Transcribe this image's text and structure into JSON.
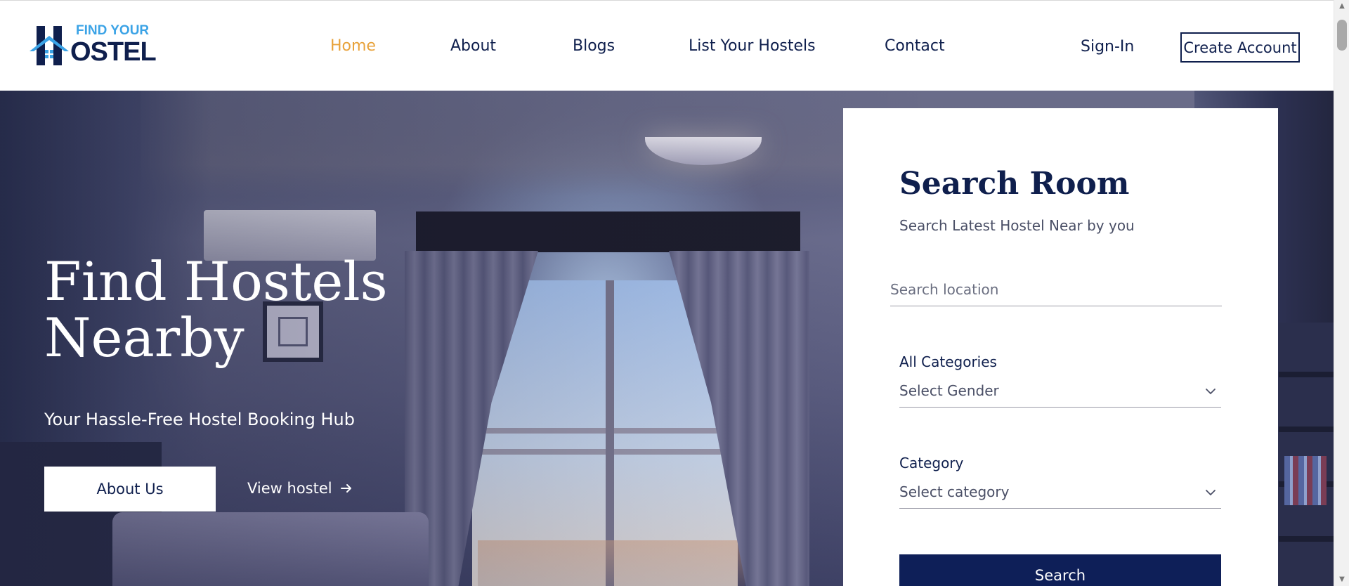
{
  "header": {
    "logo_text_top": "FIND YOUR",
    "logo_text_bottom": "OSTEL",
    "logo_letter": "H",
    "nav": [
      {
        "label": "Home",
        "active": true
      },
      {
        "label": "About",
        "active": false
      },
      {
        "label": "Blogs",
        "active": false
      },
      {
        "label": "List Your Hostels",
        "active": false
      },
      {
        "label": "Contact",
        "active": false
      }
    ],
    "signin_label": "Sign-In",
    "create_account_label": "Create Account"
  },
  "hero": {
    "title_line1": "Find Hostels",
    "title_line2": "Nearby",
    "subtitle": "Your Hassle-Free Hostel Booking Hub",
    "about_button": "About Us",
    "view_link": "View hostel",
    "view_link_icon": "arrow-right-icon"
  },
  "search": {
    "title": "Search Room",
    "subtitle": "Search Latest Hostel Near by you",
    "location_placeholder": "Search location",
    "location_value": "",
    "gender_label": "All Categories",
    "gender_select": "Select Gender",
    "category_label": "Category",
    "category_select": "Select category",
    "search_button": "Search"
  },
  "colors": {
    "accent": "#e8a23a",
    "navy": "#0f1f4d",
    "button_navy": "#0e1f58",
    "logo_blue": "#3ba3e6"
  }
}
